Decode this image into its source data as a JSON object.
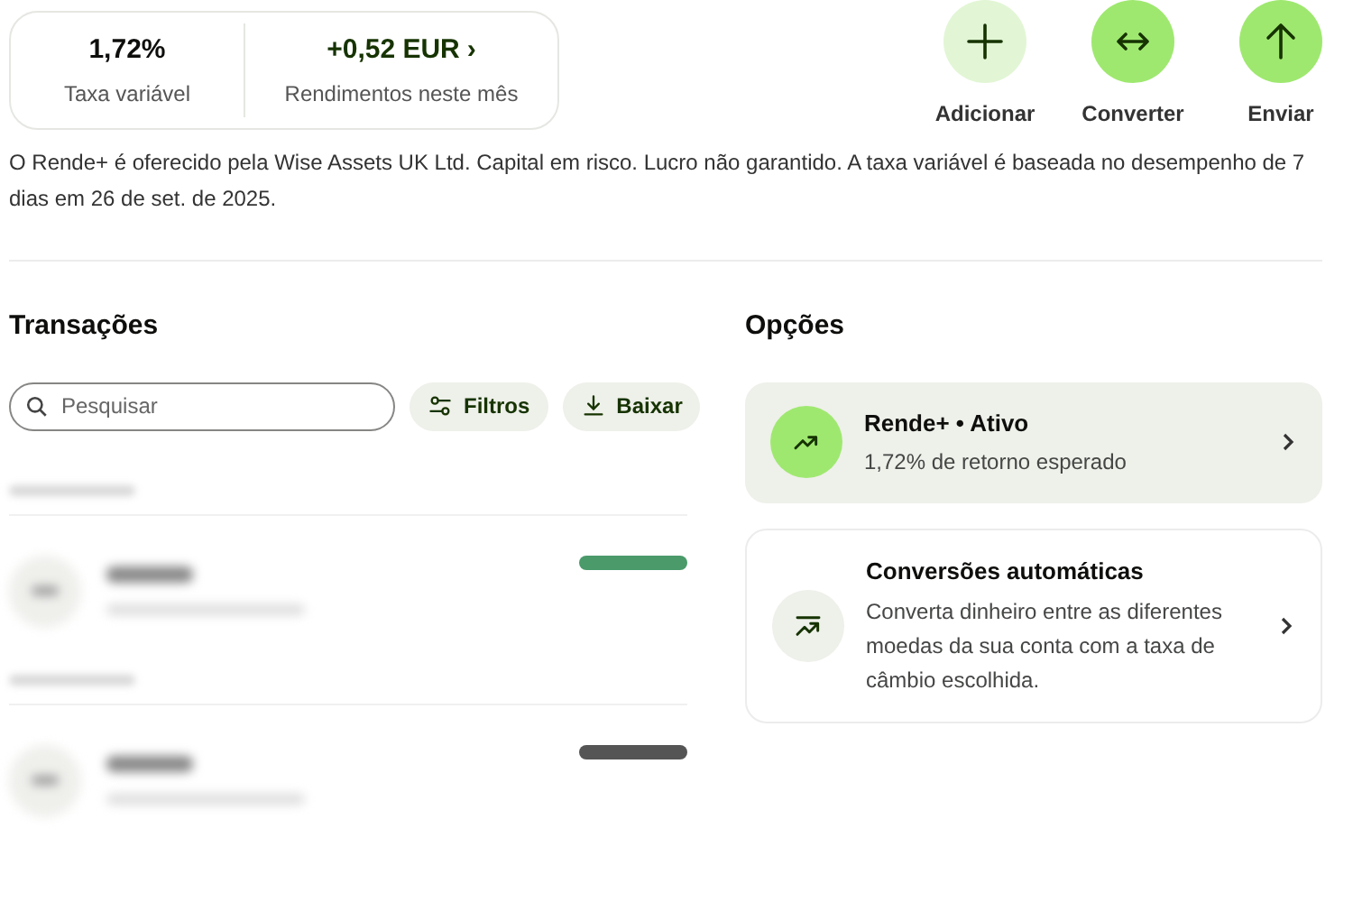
{
  "summary": {
    "rate": "1,72%",
    "rate_label": "Taxa variável",
    "earnings": "+0,52 EUR",
    "earnings_chevron": "›",
    "earnings_label": "Rendimentos neste mês"
  },
  "actions": [
    {
      "kind": "add",
      "label": "Adicionar",
      "highlighted": false
    },
    {
      "kind": "convert",
      "label": "Converter",
      "highlighted": true
    },
    {
      "kind": "send",
      "label": "Enviar",
      "highlighted": true
    }
  ],
  "disclaimer": "O Rende+ é oferecido pela Wise Assets UK Ltd. Capital em risco. Lucro não garantido. A taxa variável é baseada no desempenho de 7 dias em 26 de set. de 2025.",
  "transactions": {
    "title": "Transações",
    "search": {
      "placeholder": "Pesquisar"
    },
    "buttons": [
      {
        "kind": "filter",
        "label": "Filtros"
      },
      {
        "kind": "download",
        "label": "Baixar"
      }
    ],
    "groups": [
      {
        "items": [
          {
            "color": "#4a9a6a"
          }
        ]
      },
      {
        "items": [
          {
            "color": "#555555"
          }
        ]
      }
    ]
  },
  "options": {
    "title": "Opções",
    "cards": [
      {
        "kind": "yield",
        "title": "Rende+ • Ativo",
        "subtitle": "1,72% de retorno esperado",
        "active": true
      },
      {
        "kind": "auto",
        "title": "Conversões automáticas",
        "subtitle": "Converta dinheiro entre as diferentes moedas da sua conta com a taxa de câmbio escolhida.",
        "active": false
      }
    ]
  }
}
